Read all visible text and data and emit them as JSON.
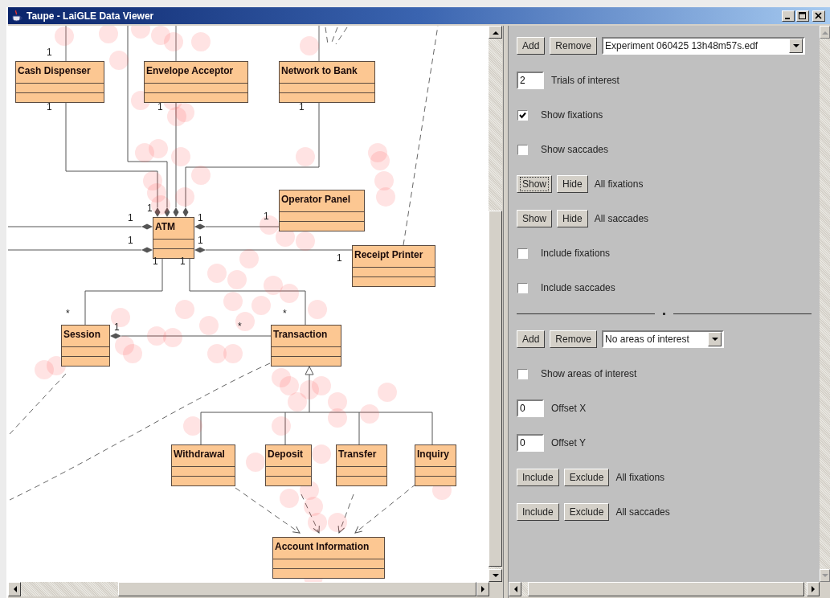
{
  "window": {
    "title": "Taupe - LaiGLE Data Viewer"
  },
  "diagram": {
    "classes": [
      {
        "name": "Cash Dispenser"
      },
      {
        "name": "Envelope Acceptor"
      },
      {
        "name": "Network to Bank"
      },
      {
        "name": "ATM"
      },
      {
        "name": "Operator Panel"
      },
      {
        "name": "Receipt Printer"
      },
      {
        "name": "Session"
      },
      {
        "name": "Transaction"
      },
      {
        "name": "Withdrawal"
      },
      {
        "name": "Deposit"
      },
      {
        "name": "Transfer"
      },
      {
        "name": "Inquiry"
      },
      {
        "name": "Account Information"
      }
    ],
    "multiplicities": [
      "1",
      "1",
      "1",
      "1",
      "1",
      "1",
      "1",
      "1",
      "1",
      "1",
      "1",
      "1",
      "1",
      "*",
      "1",
      "*",
      "*"
    ]
  },
  "panel": {
    "rows": [
      {
        "kind": "picker",
        "buttons": [
          {
            "label": "Add",
            "focused": false
          },
          {
            "label": "Remove",
            "focused": false
          }
        ],
        "value": "Experiment 060425 13h48m57s.edf"
      },
      {
        "kind": "number",
        "value": "2",
        "label": "Trials of interest"
      },
      {
        "kind": "checkbox",
        "label": "Show fixations",
        "checked": true
      },
      {
        "kind": "checkbox",
        "label": "Show saccades",
        "checked": false
      },
      {
        "kind": "buttons",
        "buttons": [
          {
            "label": "Show",
            "focused": true
          },
          {
            "label": "Hide",
            "focused": false
          }
        ],
        "label": "All fixations"
      },
      {
        "kind": "buttons",
        "buttons": [
          {
            "label": "Show",
            "focused": false
          },
          {
            "label": "Hide",
            "focused": false
          }
        ],
        "label": "All saccades"
      },
      {
        "kind": "checkbox",
        "label": "Include fixations",
        "checked": false
      },
      {
        "kind": "checkbox",
        "label": "Include saccades",
        "checked": false
      },
      {
        "kind": "separator"
      },
      {
        "kind": "picker",
        "buttons": [
          {
            "label": "Add",
            "focused": false
          },
          {
            "label": "Remove",
            "focused": false
          }
        ],
        "value": "No areas of interest"
      },
      {
        "kind": "checkbox",
        "label": "Show areas of interest",
        "checked": false
      },
      {
        "kind": "number",
        "value": "0",
        "label": "Offset X"
      },
      {
        "kind": "number",
        "value": "0",
        "label": "Offset Y"
      },
      {
        "kind": "buttons",
        "buttons": [
          {
            "label": "Include",
            "focused": false
          },
          {
            "label": "Exclude",
            "focused": false
          }
        ],
        "label": "All fixations"
      },
      {
        "kind": "buttons",
        "buttons": [
          {
            "label": "Include",
            "focused": false
          },
          {
            "label": "Exclude",
            "focused": false
          }
        ],
        "label": "All saccades"
      }
    ]
  }
}
